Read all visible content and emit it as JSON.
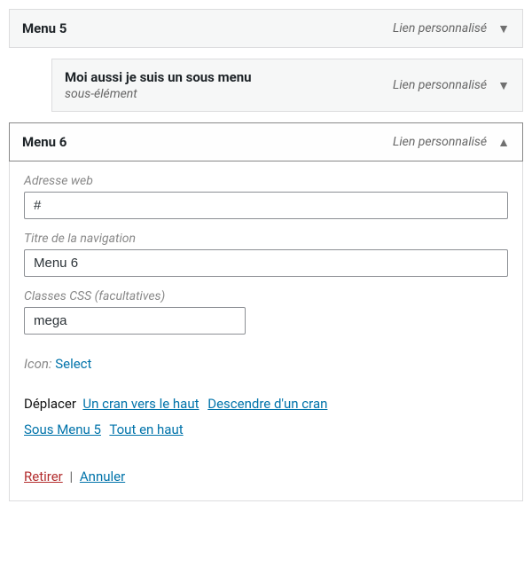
{
  "items": [
    {
      "title": "Menu 5",
      "type": "Lien personnalisé",
      "subtitle": "",
      "expanded": false
    },
    {
      "title": "Moi aussi je suis un sous menu",
      "type": "Lien personnalisé",
      "subtitle": "sous-élément",
      "expanded": false
    },
    {
      "title": "Menu 6",
      "type": "Lien personnalisé",
      "subtitle": "",
      "expanded": true
    }
  ],
  "panel": {
    "url_label": "Adresse web",
    "url_value": "#",
    "nav_title_label": "Titre de la navigation",
    "nav_title_value": "Menu 6",
    "css_label": "Classes CSS (facultatives)",
    "css_value": "mega",
    "icon_label": "Icon:",
    "icon_select": "Select",
    "move_label": "Déplacer",
    "move_up": "Un cran vers le haut",
    "move_down": "Descendre d'un cran",
    "move_under": "Sous Menu 5",
    "move_top": "Tout en haut",
    "remove": "Retirer",
    "separator": "|",
    "cancel": "Annuler"
  }
}
